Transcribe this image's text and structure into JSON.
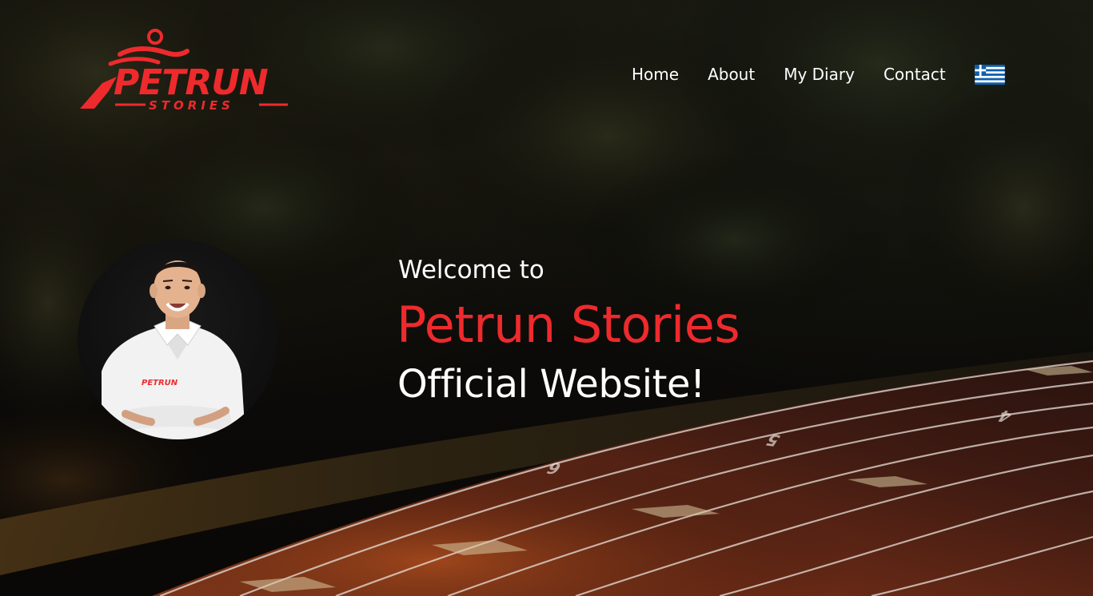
{
  "logo": {
    "word": "PETRUN",
    "sub": "STORIES"
  },
  "nav": {
    "items": [
      {
        "label": "Home"
      },
      {
        "label": "About"
      },
      {
        "label": "My Diary"
      },
      {
        "label": "Contact"
      }
    ],
    "language_flag": "greek-flag-icon"
  },
  "hero": {
    "welcome": "Welcome to",
    "brand": "Petrun Stories",
    "tagline": "Official Website!",
    "shirt_logo": "PETRUN"
  },
  "track": {
    "lane_numbers": [
      "6",
      "5",
      "4"
    ]
  },
  "colors": {
    "accent": "#ee2a2d",
    "text": "#ffffff",
    "track": "#5a2416"
  }
}
